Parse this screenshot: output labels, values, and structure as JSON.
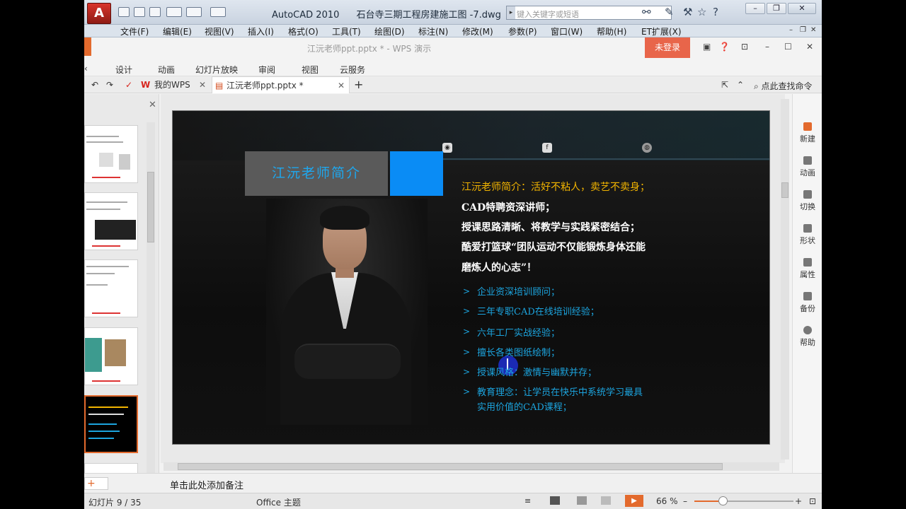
{
  "acad": {
    "app": "AutoCAD 2010",
    "file": "石台寺三期工程房建施工图 -7.dwg",
    "search_placeholder": "键入关键字或短语",
    "menu": [
      "文件(F)",
      "编辑(E)",
      "视图(V)",
      "插入(I)",
      "格式(O)",
      "工具(T)",
      "绘图(D)",
      "标注(N)",
      "修改(M)",
      "参数(P)",
      "窗口(W)",
      "帮助(H)",
      "ET扩展(X)"
    ]
  },
  "wps": {
    "caption": "江沅老师ppt.pptx * - WPS 演示",
    "login": "未登录",
    "ribbon": [
      "设计",
      "动画",
      "幻灯片放映",
      "审阅",
      "视图",
      "云服务"
    ],
    "tabs": {
      "home": "我的WPS",
      "doc": "江沅老师ppt.pptx *"
    },
    "find": "点此查找命令"
  },
  "slide": {
    "title": "江沅老师简介",
    "lines": {
      "l1": "江沅老师简介：活好不粘人，卖艺不卖身；",
      "l2": "CAD特聘资深讲师；",
      "l3": "授课思路清晰、将教学与实践紧密结合；",
      "l4": "酷爱打篮球“团队运动不仅能锻炼身体还能",
      "l5": "磨炼人的心志”！"
    },
    "bullets": {
      "b1": "企业资深培训顾问；",
      "b2": "三年专职CAD在线培训经验；",
      "b3": "六年工厂实战经验；",
      "b4": "擅长各类图纸绘制；",
      "b5": "授课风格：激情与幽默并存；",
      "b6a": "教育理念：让学员在快乐中系统学习最具",
      "b6b": "实用价值的CAD课程；"
    },
    "bullet_glyph": ">"
  },
  "right_panel": {
    "new": "新建",
    "anim": "动画",
    "switch": "切换",
    "shape": "形状",
    "prop": "属性",
    "backup": "备份",
    "help": "帮助"
  },
  "notes": {
    "placeholder": "单击此处添加备注"
  },
  "status": {
    "slide": "幻灯片 9 / 35",
    "theme": "Office 主题",
    "zoom": "66 %",
    "zoom_level": 0.66
  },
  "colors": {
    "accent": "#e36a2d",
    "title_blue": "#1ea7ee",
    "text_orange": "#f2b400",
    "text_blue": "#1ca4de"
  }
}
